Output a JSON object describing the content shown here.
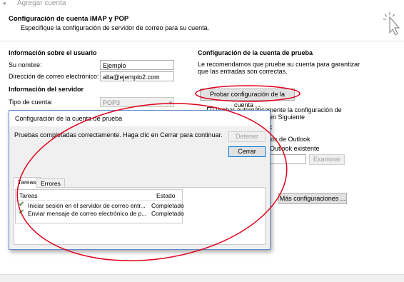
{
  "window": {
    "title": "Agregar cuenta"
  },
  "header": {
    "title": "Configuración de cuenta IMAP y POP",
    "subtitle": "Especifique la configuración de servidor de correo para su cuenta."
  },
  "user_info": {
    "heading": "Información sobre el usuario",
    "name_label": "Su nombre:",
    "name_value": "Ejemplo",
    "email_label": "Dirección de correo electrónico:",
    "email_value": "alta@ejemplo2.com"
  },
  "server_info": {
    "heading": "Información del servidor",
    "account_type_label": "Tipo de cuenta:",
    "account_type_value": "POP3"
  },
  "test_settings": {
    "heading": "Configuración de la cuenta de prueba",
    "description_line1": "Le recomendamos que pruebe su cuenta para garantizar",
    "description_line2": "que las entradas son correctas.",
    "test_button": "Probar configuración de la cuenta ...",
    "auto_test_line1": "Probar automáticamente la configuración de",
    "auto_test_line2": "en Siguiente",
    "partial_c": "c",
    "partial_outlook": "os de Outlook",
    "partial_existing": "Outlook existente",
    "browse_button": "Examinar",
    "more_settings_button": "Más configuraciones ..."
  },
  "dialog": {
    "title": "Configuración de la cuenta de prueba",
    "message": "Pruebas completadas correctamente. Haga clic en Cerrar para continuar.",
    "stop_button": "Detener",
    "close_button": "Cerrar",
    "tabs": [
      {
        "label": "Tareas"
      },
      {
        "label": "Errores"
      }
    ],
    "columns": {
      "task": "Tareas",
      "status": "Estado"
    },
    "rows": [
      {
        "task": "Iniciar sesión en el servidor de correo entr...",
        "status": "Completado"
      },
      {
        "task": "Enviar mensaje de correo electrónico de p...",
        "status": "Completado"
      }
    ]
  },
  "colors": {
    "annotation": "#e0001b",
    "success_check": "#2e8b2e",
    "dialog_border": "#5a86c8"
  }
}
